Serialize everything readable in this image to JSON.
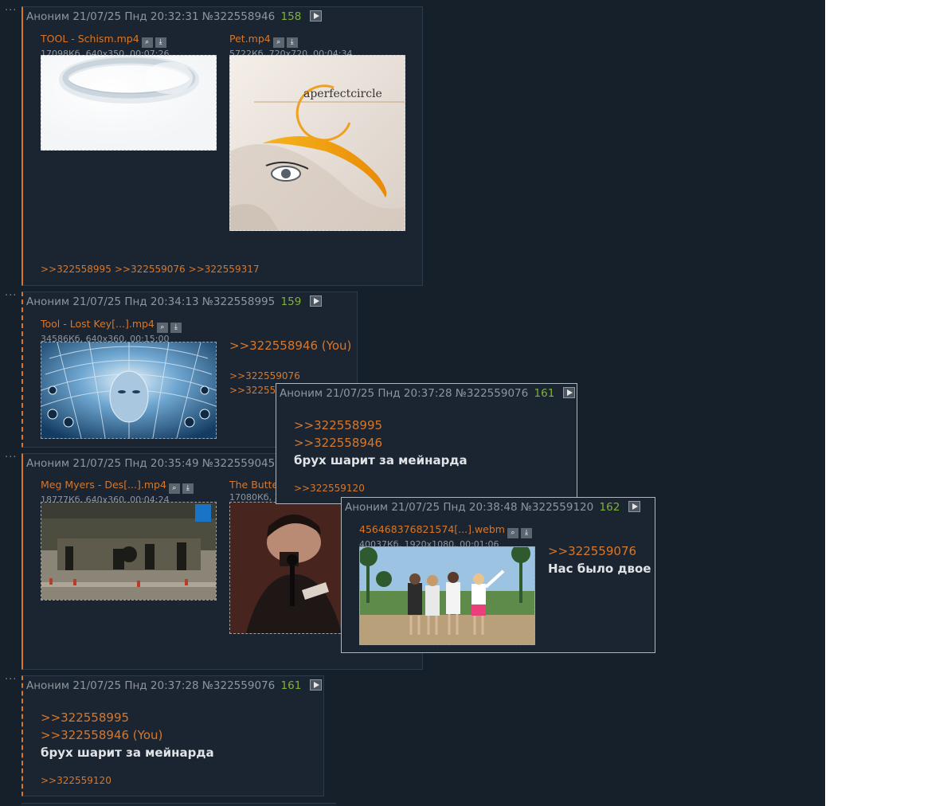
{
  "posts": [
    {
      "author": "Аноним",
      "date": "21/07/25 Пнд 20:32:31",
      "num": "№322558946",
      "count": "158",
      "files": [
        {
          "name": "TOOL - Schism.mp4",
          "meta": "17098Кб, 640x350, 00:07:26"
        },
        {
          "name": "Pet.mp4",
          "meta": "5722Кб, 720x720, 00:04:34",
          "art_text": "aperfectcircle"
        }
      ],
      "backlinks": [
        ">>322558995",
        ">>322559076",
        ">>322559317"
      ]
    },
    {
      "author": "Аноним",
      "date": "21/07/25 Пнд 20:34:13",
      "num": "№322558995",
      "count": "159",
      "files": [
        {
          "name": "Tool - Lost Key[...].mp4",
          "meta": "34586Кб, 640x360, 00:15:00"
        }
      ],
      "reply": ">>322558946 (You)",
      "backlinks": [
        ">>322559076",
        ">>32255931"
      ]
    },
    {
      "author": "Аноним",
      "date": "21/07/25 Пнд 20:35:49",
      "num": "№322559045",
      "files": [
        {
          "name": "Meg Myers - Des[...].mp4",
          "meta": "18777Кб, 640x360, 00:04:24"
        },
        {
          "name": "The Butte",
          "meta": "17080Кб, 3"
        }
      ]
    },
    {
      "author": "Аноним",
      "date": "21/07/25 Пнд 20:37:28",
      "num": "№322559076",
      "count": "161",
      "replies": [
        ">>322558995",
        ">>322558946 (You)"
      ],
      "text": "брух шарит за мейнарда",
      "backlinks": [
        ">>322559120"
      ]
    }
  ],
  "popups": [
    {
      "author": "Аноним",
      "date": "21/07/25 Пнд 20:37:28",
      "num": "№322559076",
      "count": "161",
      "replies": [
        ">>322558995",
        ">>322558946"
      ],
      "text": "брух шарит за мейнарда",
      "backlinks": [
        ">>322559120"
      ]
    },
    {
      "author": "Аноним",
      "date": "21/07/25 Пнд 20:38:48",
      "num": "№322559120",
      "count": "162",
      "file": {
        "name": "456468376821574[...].webm",
        "meta": "40037Кб, 1920x1080, 00:01:06"
      },
      "reply": ">>322559076",
      "text": "Нас было двое"
    }
  ],
  "icons": {
    "search": "magnifier-icon",
    "download": "download-icon",
    "play": "play-icon",
    "menu": "dots-icon"
  },
  "colors": {
    "board_bg": "#16202b",
    "post_bg": "#1b2531",
    "accent": "#d7772a",
    "count": "#7fb13a",
    "text": "#e1e4e7",
    "muted": "#8d96a0"
  }
}
